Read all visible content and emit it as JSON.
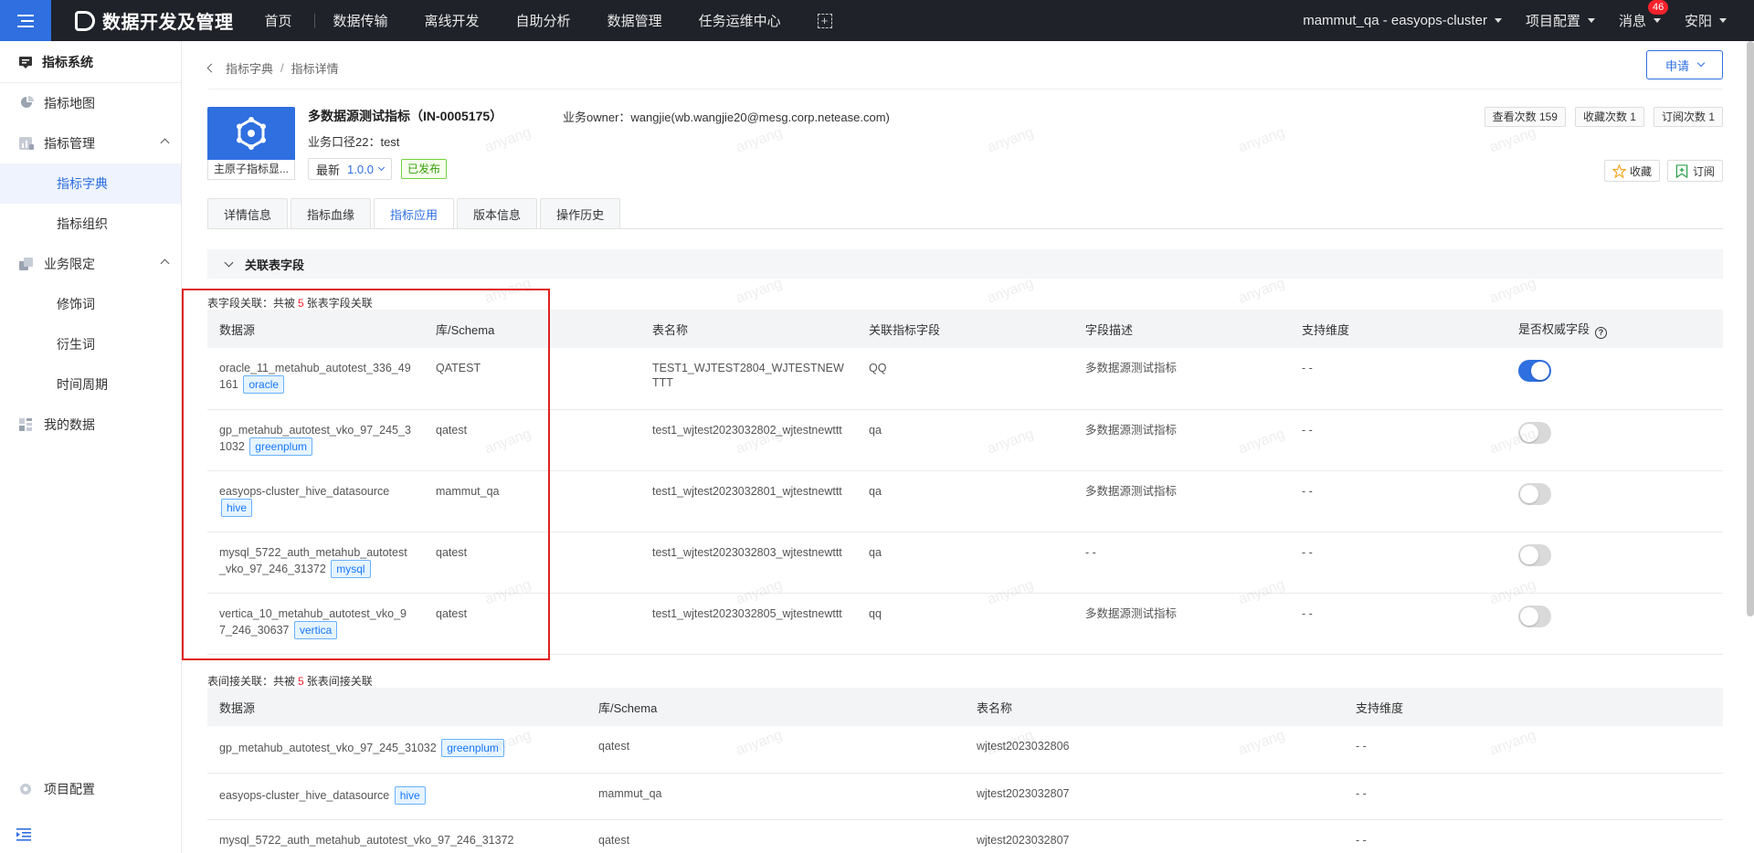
{
  "topbar": {
    "brand": "数据开发及管理",
    "nav": [
      "首页",
      "数据传输",
      "离线开发",
      "自助分析",
      "数据管理",
      "任务运维中心"
    ],
    "cluster": "mammut_qa - easyops-cluster",
    "project_config": "项目配置",
    "messages": "消息",
    "message_count": "46",
    "user": "安阳"
  },
  "sidebar": {
    "header": "指标系统",
    "items": [
      {
        "label": "指标地图",
        "icon": "map-icon"
      },
      {
        "label": "指标管理",
        "icon": "chart-icon"
      },
      {
        "label": "指标字典",
        "sub": true,
        "active": true
      },
      {
        "label": "指标组织",
        "sub": true
      },
      {
        "label": "业务限定",
        "icon": "cube-icon"
      },
      {
        "label": "修饰词",
        "sub": true
      },
      {
        "label": "衍生词",
        "sub": true
      },
      {
        "label": "时间周期",
        "sub": true
      },
      {
        "label": "我的数据",
        "icon": "grid-icon"
      }
    ],
    "bottom": "项目配置"
  },
  "breadcrumb": {
    "parent": "指标字典",
    "current": "指标详情"
  },
  "apply_button": "申请",
  "metric": {
    "icon_label": "主原子指标显...",
    "title": "多数据源测试指标（IN-0005175）",
    "owner_label": "业务owner：",
    "owner": "wangjie(wb.wangjie20@mesg.corp.netease.com)",
    "caliber": "业务口径22：test",
    "version_prefix": "最新",
    "version": "1.0.0",
    "status": "已发布",
    "views": "查看次数 159",
    "favorites": "收藏次数 1",
    "subscriptions": "订阅次数 1",
    "favorite_btn": "收藏",
    "subscribe_btn": "订阅"
  },
  "tabs": [
    "详情信息",
    "指标血缘",
    "指标应用",
    "版本信息",
    "操作历史"
  ],
  "section": "关联表字段",
  "field_assoc": {
    "prefix": "表字段关联：共被",
    "count": "5",
    "suffix": "张表字段关联",
    "headers": [
      "数据源",
      "库/Schema",
      "表名称",
      "关联指标字段",
      "字段描述",
      "支持维度",
      "是否权威字段"
    ],
    "rows": [
      {
        "ds": "oracle_11_metahub_autotest_336_49161",
        "tag": "oracle",
        "schema": "QATEST",
        "table": "TEST1_WJTEST2804_WJTESTNEWTTT",
        "field": "QQ",
        "desc": "多数据源测试指标",
        "dim": "- -",
        "auth": true
      },
      {
        "ds": "gp_metahub_autotest_vko_97_245_31032",
        "tag": "greenplum",
        "schema": "qatest",
        "table": "test1_wjtest2023032802_wjtestnewttt",
        "field": "qa",
        "desc": "多数据源测试指标",
        "dim": "- -",
        "auth": false
      },
      {
        "ds": "easyops-cluster_hive_datasource",
        "tag": "hive",
        "schema": "mammut_qa",
        "table": "test1_wjtest2023032801_wjtestnewttt",
        "field": "qa",
        "desc": "多数据源测试指标",
        "dim": "- -",
        "auth": false
      },
      {
        "ds": "mysql_5722_auth_metahub_autotest_vko_97_246_31372",
        "tag": "mysql",
        "schema": "qatest",
        "table": "test1_wjtest2023032803_wjtestnewttt",
        "field": "qa",
        "desc": "- -",
        "dim": "- -",
        "auth": false
      },
      {
        "ds": "vertica_10_metahub_autotest_vko_97_246_30637",
        "tag": "vertica",
        "schema": "qatest",
        "table": "test1_wjtest2023032805_wjtestnewttt",
        "field": "qq",
        "desc": "多数据源测试指标",
        "dim": "- -",
        "auth": false
      }
    ]
  },
  "indirect_assoc": {
    "prefix": "表间接关联：共被",
    "count": "5",
    "suffix": "张表间接关联",
    "headers": [
      "数据源",
      "库/Schema",
      "表名称",
      "支持维度"
    ],
    "rows": [
      {
        "ds": "gp_metahub_autotest_vko_97_245_31032",
        "tag": "greenplum",
        "schema": "qatest",
        "table": "wjtest2023032806",
        "dim": "- -"
      },
      {
        "ds": "easyops-cluster_hive_datasource",
        "tag": "hive",
        "schema": "mammut_qa",
        "table": "wjtest2023032807",
        "dim": "- -"
      },
      {
        "ds": "mysql_5722_auth_metahub_autotest_vko_97_246_31372",
        "tag": "",
        "schema": "qatest",
        "table": "wjtest2023032807",
        "dim": "- -"
      }
    ]
  },
  "watermark": "anyang",
  "colors": {
    "primary": "#2f6fe0",
    "topbar": "#1f2228",
    "highlight": "#e02020"
  }
}
